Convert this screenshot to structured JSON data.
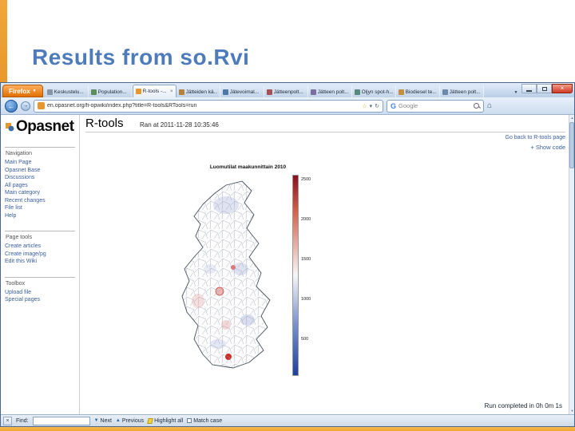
{
  "slide": {
    "title": "Results from so.Rvi"
  },
  "icons": {
    "caret": "▼",
    "back_arrow": "←",
    "forward_arrow": "→",
    "dropdown": "▾",
    "reload": "↻",
    "star": "☆",
    "home": "⌂",
    "close": "×",
    "up_arrow": "▲",
    "down_arrow": "▼",
    "list_tabs": "▼"
  },
  "browser": {
    "menu_button": "Firefox",
    "tabs": [
      {
        "label": "Keskustelu..."
      },
      {
        "label": "Population..."
      },
      {
        "label": "R-tools -..."
      },
      {
        "label": "Jätteiden kä..."
      },
      {
        "label": "Jätevoimal..."
      },
      {
        "label": "Jätteenpolt..."
      },
      {
        "label": "Jätteen polt..."
      },
      {
        "label": "Öljyn spot-h..."
      },
      {
        "label": "Biodiesel te..."
      },
      {
        "label": "Jätteen polt..."
      }
    ],
    "url": "en.opasnet.org/fi-opwiki/index.php?title=R-tools&RTools=run",
    "search_placeholder": "Google",
    "findbar": {
      "label": "Find:",
      "value": "",
      "next": "Next",
      "previous": "Previous",
      "highlight_all": "Highlight all",
      "match_case": "Match case"
    }
  },
  "wiki": {
    "logo": "Opasnet",
    "sidebar": {
      "nav_header": "Navigation",
      "nav_items": [
        "Main Page",
        "Opasnet Base",
        "Discussions",
        "All pages",
        "Main category",
        "Recent changes",
        "File list",
        "Help"
      ],
      "tools_header": "Page tools",
      "tools_items": [
        "Create articles",
        "Create image/pg",
        "Edit this Wiki"
      ],
      "toolbox_header": "Toolbox",
      "toolbox_items": [
        "Upload file",
        "Special pages"
      ]
    },
    "page_title": "R-tools",
    "ran_at": "Ran at 2011-11-28 10:35:46",
    "top_link": "Go back to R-tools page",
    "show_code": "+ Show code",
    "run_completed": "Run completed in 0h 0m 1s"
  },
  "chart_data": {
    "type": "choropleth-map",
    "title": "Luomutilat maakunnittain 2010",
    "region": "Finland, municipal boundaries",
    "legend_position": "right",
    "colorbar": {
      "tick_labels": [
        "2500",
        "2000",
        "1500",
        "1000",
        "500"
      ],
      "high_color": "#8b0f1e",
      "mid_color": "#f7f7f7",
      "low_color": "#1f3f9e"
    }
  }
}
